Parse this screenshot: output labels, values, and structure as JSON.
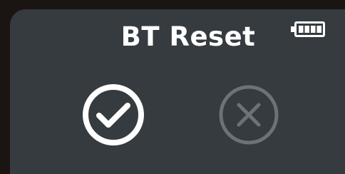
{
  "screen": {
    "title": "BT Reset"
  },
  "status": {
    "battery_icon": "battery-icon",
    "battery_level": 1.0
  },
  "actions": {
    "confirm_icon": "check-circle-icon",
    "cancel_icon": "x-circle-icon",
    "confirm_state": "active",
    "cancel_state": "disabled"
  },
  "colors": {
    "background": "#353b3e",
    "bezel": "#1a1412",
    "primary": "#ffffff",
    "muted": "#6a7376"
  }
}
